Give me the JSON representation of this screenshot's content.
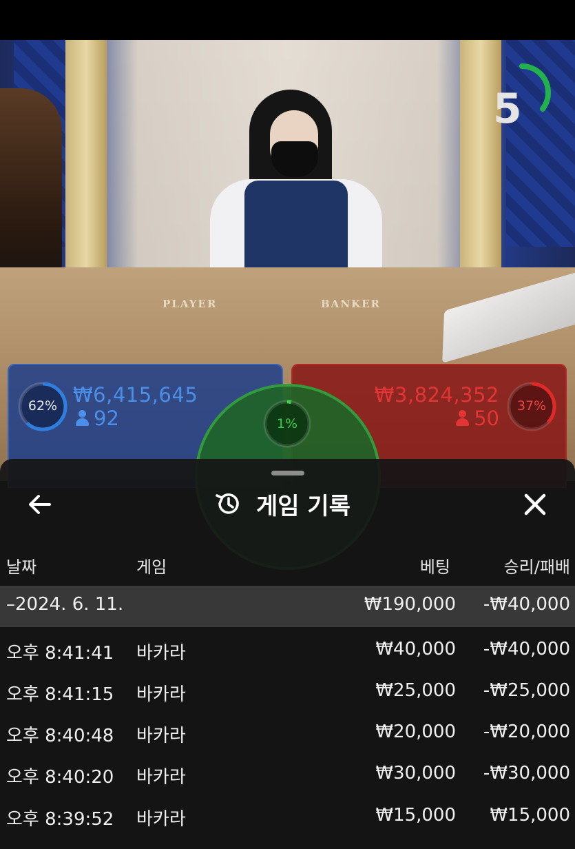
{
  "video": {
    "table_player_word": "PLAYER",
    "table_banker_word": "BANKER",
    "timer_value": "5",
    "timer_color": "#22b14c"
  },
  "betting": {
    "player": {
      "percent": "62%",
      "percent_value": 0.62,
      "amount": "₩6,415,645",
      "count": "92",
      "color": "#2f7fe0"
    },
    "tie": {
      "percent": "1%",
      "percent_value": 0.01,
      "color": "#3ccf4e"
    },
    "banker": {
      "percent": "37%",
      "percent_value": 0.37,
      "amount": "₩3,824,352",
      "count": "50",
      "color": "#e02a2a"
    }
  },
  "history": {
    "title": "게임 기록",
    "icons": {
      "back": "arrow-left-icon",
      "title": "history-icon",
      "close": "close-icon"
    },
    "headers": {
      "date": "날짜",
      "game": "게임",
      "bet": "베팅",
      "win_loss": "승리/패배"
    },
    "date_row": {
      "date": "–2024. 6. 11.",
      "bet": "₩190,000",
      "win_loss": "-₩40,000"
    },
    "rows": [
      {
        "time": "오후 8:41:41",
        "game": "바카라",
        "bet": "₩40,000",
        "win_loss": "-₩40,000"
      },
      {
        "time": "오후 8:41:15",
        "game": "바카라",
        "bet": "₩25,000",
        "win_loss": "-₩25,000"
      },
      {
        "time": "오후 8:40:48",
        "game": "바카라",
        "bet": "₩20,000",
        "win_loss": "-₩20,000"
      },
      {
        "time": "오후 8:40:20",
        "game": "바카라",
        "bet": "₩30,000",
        "win_loss": "-₩30,000"
      },
      {
        "time": "오후 8:39:52",
        "game": "바카라",
        "bet": "₩15,000",
        "win_loss": "₩15,000"
      }
    ]
  }
}
